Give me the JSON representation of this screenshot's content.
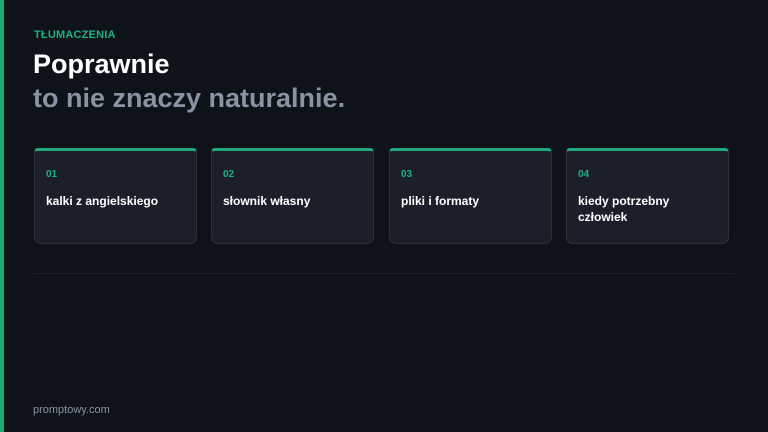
{
  "header": {
    "eyebrow": "TŁUMACZENIA",
    "title_line1": "Poprawnie",
    "title_line2": "to nie znaczy naturalnie."
  },
  "cards": [
    {
      "number": "01",
      "label": "kalki z angielskiego"
    },
    {
      "number": "02",
      "label": "słownik własny"
    },
    {
      "number": "03",
      "label": "pliki i formaty"
    },
    {
      "number": "04",
      "label": "kiedy potrzebny człowiek"
    }
  ],
  "footer": {
    "site": "promptowy.com"
  },
  "colors": {
    "accent": "#1fa97a",
    "background": "#0e1219",
    "card_background": "#1b1f29",
    "title": "#ffffff",
    "subtitle": "#8b93a3"
  }
}
